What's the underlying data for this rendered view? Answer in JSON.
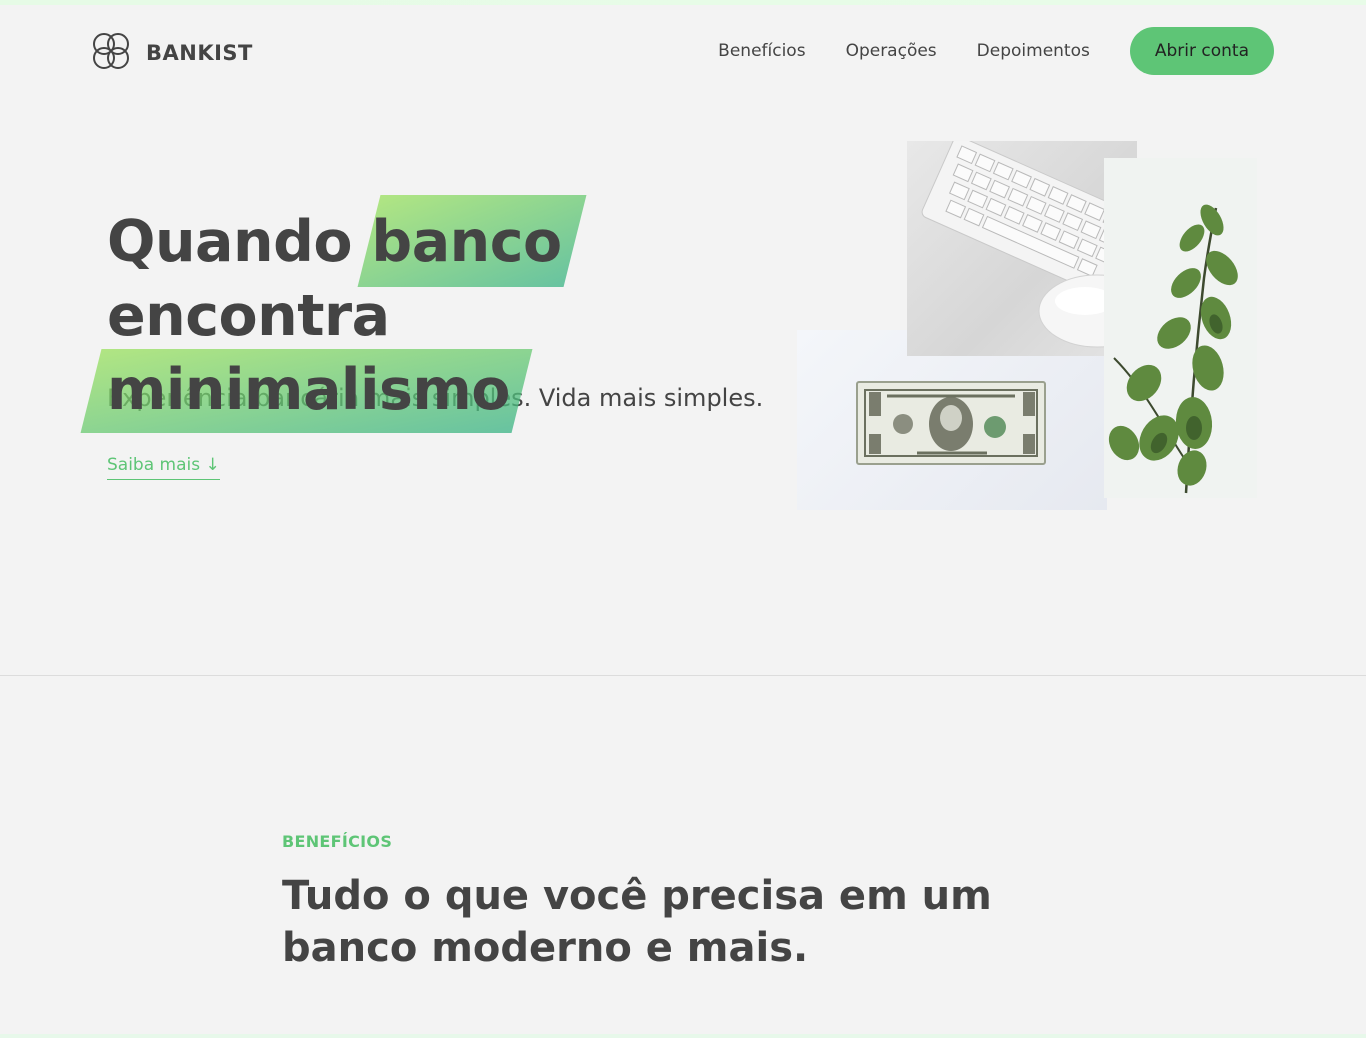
{
  "brand": {
    "name": "BANKIST",
    "accent_color": "#5ec576",
    "gradient_start": "#9be15d",
    "gradient_end": "#39b385"
  },
  "nav": {
    "links": [
      "Benefícios",
      "Operações",
      "Depoimentos"
    ],
    "cta_label": "Abrir conta"
  },
  "hero": {
    "title_word_1": "Quando",
    "title_highlight_1": "banco",
    "title_word_2": "encontra",
    "title_highlight_2": "minimalismo",
    "subtitle": "Experiência bancária mais simples. Vida mais simples.",
    "link_label": "Saiba mais ↓",
    "image_icons": [
      "keyboard-mouse-image",
      "dollar-bill-image",
      "plant-image"
    ]
  },
  "features": {
    "label": "BENEFÍCIOS",
    "heading": "Tudo o que você precisa em um banco moderno e mais."
  }
}
